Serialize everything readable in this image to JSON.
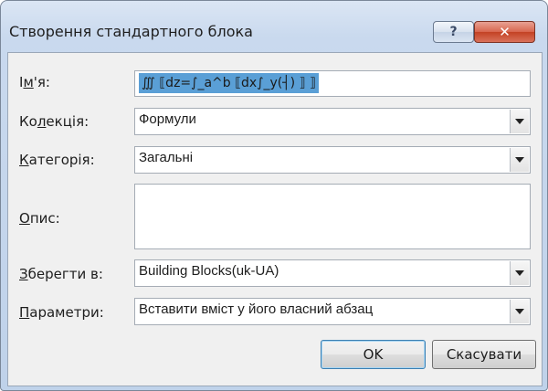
{
  "window": {
    "title": "Створення стандартного блока",
    "help_glyph": "?",
    "close_glyph": "✕"
  },
  "form": {
    "name": {
      "label_pre": "І",
      "label_accel": "м",
      "label_post": "'я:",
      "value": "∭ ⟦dz=∫_a^b ⟦dx∫_y(┤) ⟧ ⟧"
    },
    "collection": {
      "label_pre": "Ко",
      "label_accel": "л",
      "label_post": "екція:",
      "value": "Формули"
    },
    "category": {
      "label_pre": "",
      "label_accel": "К",
      "label_post": "атегорія:",
      "value": "Загальні"
    },
    "description": {
      "label_pre": "",
      "label_accel": "О",
      "label_post": "пис:",
      "value": ""
    },
    "save_in": {
      "label_pre": "",
      "label_accel": "З",
      "label_post": "берегти в:",
      "value": "Building Blocks(uk-UA)"
    },
    "options": {
      "label_pre": "",
      "label_accel": "П",
      "label_post": "араметри:",
      "value": "Вставити вміст у його власний абзац"
    }
  },
  "buttons": {
    "ok": "OK",
    "cancel": "Скасувати"
  }
}
